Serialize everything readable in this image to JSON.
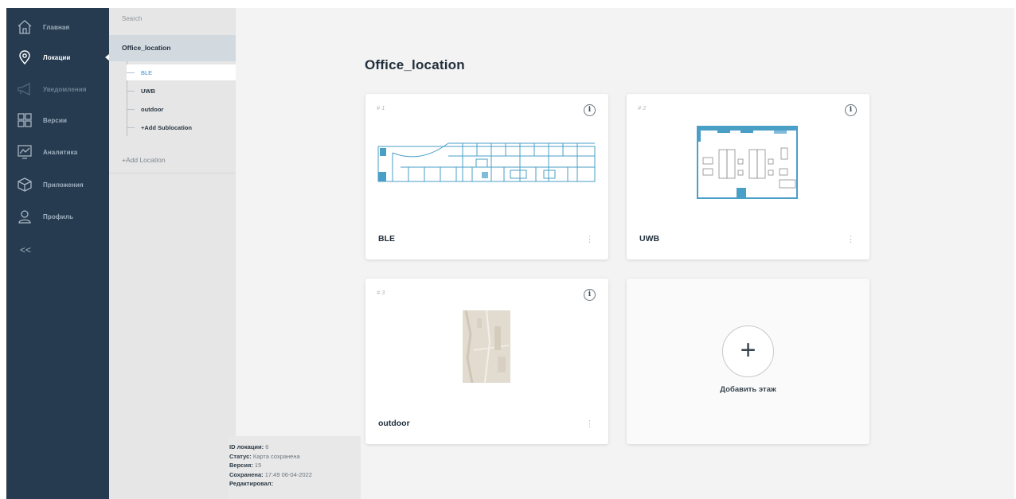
{
  "nav": {
    "items": [
      {
        "label": "Главная",
        "icon": "home-icon"
      },
      {
        "label": "Локации",
        "icon": "location-pin-icon"
      },
      {
        "label": "Уведомления",
        "icon": "megaphone-icon"
      },
      {
        "label": "Версии",
        "icon": "grid-icon"
      },
      {
        "label": "Аналитика",
        "icon": "chart-icon"
      },
      {
        "label": "Приложения",
        "icon": "box-icon"
      },
      {
        "label": "Профиль",
        "icon": "user-icon"
      }
    ],
    "collapse_label": "<<"
  },
  "tree": {
    "search_placeholder": "Search",
    "root_label": "Office_location",
    "children": [
      {
        "label": "BLE"
      },
      {
        "label": "UWB"
      },
      {
        "label": "outdoor"
      },
      {
        "label": "+Add Sublocation"
      }
    ],
    "add_location_label": "+Add Location"
  },
  "info": {
    "id_label": "ID локации:",
    "id_value": "6",
    "status_label": "Статус:",
    "status_value": "Карта сохранена",
    "version_label": "Версия:",
    "version_value": "15",
    "saved_label": "Сохранена:",
    "saved_value": "17:49 06-04-2022",
    "edited_label": "Редактировал:"
  },
  "main": {
    "title": "Office_location",
    "cards": [
      {
        "number": "# 1",
        "name": "BLE",
        "info_icon": "i",
        "menu_icon": "⋮"
      },
      {
        "number": "# 2",
        "name": "UWB",
        "info_icon": "i",
        "menu_icon": "⋮"
      },
      {
        "number": "# 3",
        "name": "outdoor",
        "info_icon": "i",
        "menu_icon": "⋮"
      }
    ],
    "add_floor": {
      "plus": "+",
      "label": "Добавить этаж"
    }
  },
  "colors": {
    "sidebar": "#263b4f",
    "accent": "#3a8fd0",
    "plan_stroke": "#4a9fc7"
  }
}
